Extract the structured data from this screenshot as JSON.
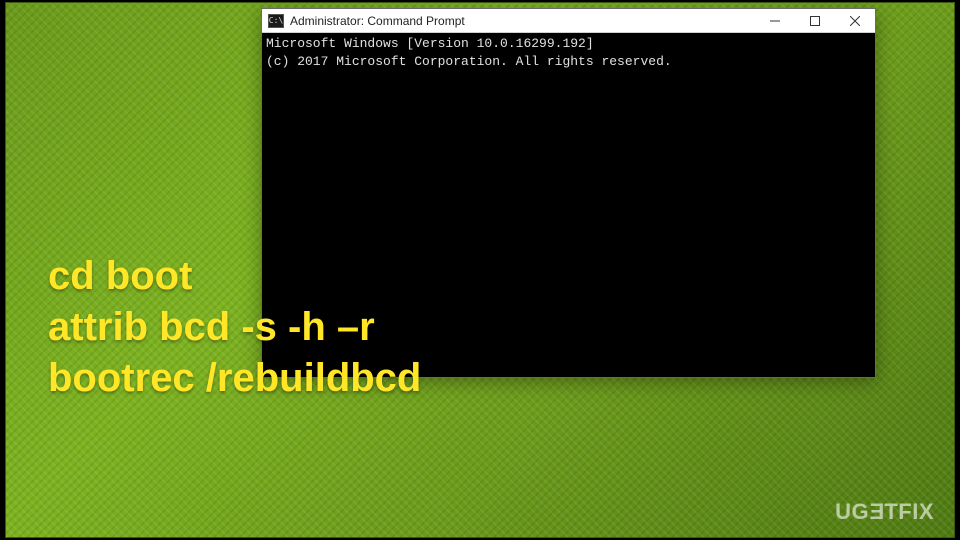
{
  "window": {
    "icon_label": "C:\\",
    "title": "Administrator: Command Prompt",
    "controls": {
      "minimize": "minimize",
      "maximize": "maximize",
      "close": "close"
    }
  },
  "terminal": {
    "line1": "Microsoft Windows [Version 10.0.16299.192]",
    "line2": "(c) 2017 Microsoft Corporation. All rights reserved."
  },
  "overlay": {
    "line1": "cd boot",
    "line2": "attrib bcd -s -h –r",
    "line3": "bootrec /rebuildbcd"
  },
  "watermark": {
    "part1": "UG",
    "part2": "E",
    "part3": "TFIX"
  }
}
